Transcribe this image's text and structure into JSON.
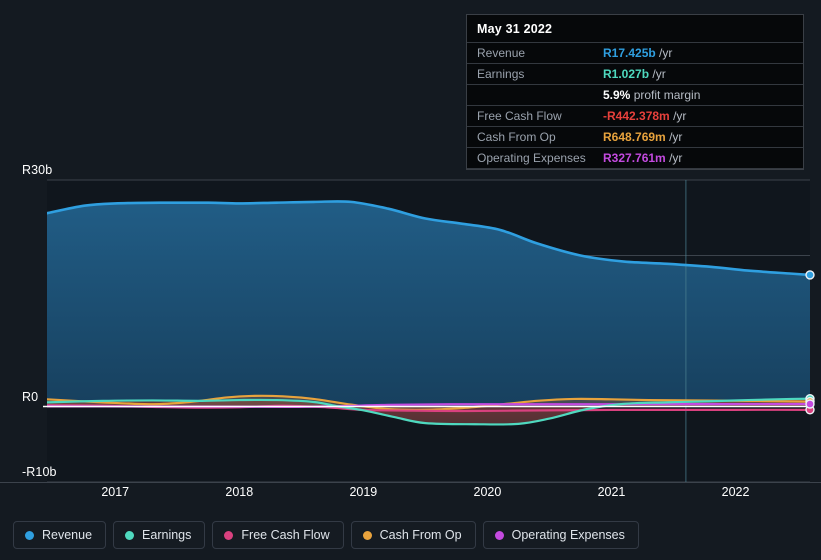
{
  "tooltip": {
    "date": "May 31 2022",
    "rows": [
      {
        "key": "Revenue",
        "amount": "R17.425b",
        "unit": "/yr",
        "color": "#2f9fe0"
      },
      {
        "key": "Earnings",
        "amount": "R1.027b",
        "unit": "/yr",
        "color": "#4fd9bf"
      },
      {
        "key": "",
        "amount": "5.9%",
        "unit": "profit margin",
        "color": "#ffffff",
        "is_margin": true
      },
      {
        "key": "Free Cash Flow",
        "amount": "-R442.378m",
        "unit": "/yr",
        "color": "#e8413c"
      },
      {
        "key": "Cash From Op",
        "amount": "R648.769m",
        "unit": "/yr",
        "color": "#e8a33d"
      },
      {
        "key": "Operating Expenses",
        "amount": "R327.761m",
        "unit": "/yr",
        "color": "#c44ae0"
      }
    ]
  },
  "legend": {
    "items": [
      {
        "label": "Revenue",
        "color": "#2f9fe0"
      },
      {
        "label": "Earnings",
        "color": "#4fd9bf"
      },
      {
        "label": "Free Cash Flow",
        "color": "#d9417f"
      },
      {
        "label": "Cash From Op",
        "color": "#e8a33d"
      },
      {
        "label": "Operating Expenses",
        "color": "#c44ae0"
      }
    ]
  },
  "chart_data": {
    "type": "area",
    "title": "",
    "xlabel": "",
    "ylabel": "",
    "currency_prefix": "R",
    "ylim": [
      -10,
      30
    ],
    "y_ticks": [
      30,
      20,
      10,
      0,
      -10
    ],
    "y_tick_labels": [
      "R30b",
      "",
      "",
      "R0",
      "-R10b"
    ],
    "grid": true,
    "zero_line": 0,
    "legend_position": "bottom-left",
    "x_tick_labels": [
      "2017",
      "2018",
      "2019",
      "2020",
      "2021",
      "2022"
    ],
    "x_tick_values": [
      2017,
      2018,
      2019,
      2020,
      2021,
      2022
    ],
    "x_range": [
      2016.45,
      2022.6
    ],
    "forecast_divider_x": 2021.6,
    "units": "ZAR billions",
    "series": [
      {
        "name": "Revenue",
        "color": "#2f9fe0",
        "fill": "#1d4a6b",
        "x": [
          2016.45,
          2016.75,
          2017.0,
          2017.4,
          2017.75,
          2018.0,
          2018.3,
          2018.6,
          2018.9,
          2019.2,
          2019.5,
          2019.8,
          2020.1,
          2020.4,
          2020.75,
          2021.1,
          2021.45,
          2021.8,
          2022.1,
          2022.45,
          2022.6
        ],
        "values": [
          25.6,
          26.6,
          26.9,
          27.0,
          27.0,
          26.9,
          27.0,
          27.1,
          27.1,
          26.2,
          24.9,
          24.2,
          23.4,
          21.6,
          20.0,
          19.2,
          18.9,
          18.5,
          18.0,
          17.6,
          17.425
        ],
        "end_value": 17.425
      },
      {
        "name": "Earnings",
        "color": "#4fd9bf",
        "fill": "#5d2a2e",
        "x": [
          2016.45,
          2016.9,
          2017.3,
          2017.7,
          2018.0,
          2018.3,
          2018.6,
          2018.8,
          2019.0,
          2019.25,
          2019.5,
          2019.9,
          2020.25,
          2020.5,
          2020.8,
          2021.1,
          2021.45,
          2021.8,
          2022.1,
          2022.45,
          2022.6
        ],
        "values": [
          0.55,
          0.75,
          0.8,
          0.75,
          0.85,
          0.85,
          0.6,
          0.0,
          -0.5,
          -1.4,
          -2.2,
          -2.35,
          -2.3,
          -1.6,
          -0.35,
          0.35,
          0.55,
          0.7,
          0.85,
          1.0,
          1.027
        ],
        "end_value": 1.027
      },
      {
        "name": "Free Cash Flow",
        "color": "#d9417f",
        "x": [
          2016.45,
          2016.9,
          2017.3,
          2017.7,
          2018.0,
          2018.35,
          2018.7,
          2019.0,
          2019.4,
          2019.8,
          2020.2,
          2020.6,
          2021.0,
          2021.4,
          2021.8,
          2022.2,
          2022.6
        ],
        "values": [
          0.15,
          0.1,
          -0.05,
          -0.15,
          -0.1,
          0.1,
          -0.1,
          -0.45,
          -0.55,
          -0.6,
          -0.55,
          -0.5,
          -0.45,
          -0.45,
          -0.45,
          -0.44,
          -0.442
        ],
        "end_value": -0.442
      },
      {
        "name": "Cash From Op",
        "color": "#e8a33d",
        "x": [
          2016.45,
          2016.9,
          2017.3,
          2017.6,
          2017.9,
          2018.1,
          2018.35,
          2018.6,
          2018.9,
          2019.2,
          2019.5,
          2019.8,
          2020.1,
          2020.4,
          2020.7,
          2021.0,
          2021.3,
          2021.7,
          2022.1,
          2022.45,
          2022.6
        ],
        "values": [
          0.95,
          0.55,
          0.3,
          0.6,
          1.2,
          1.4,
          1.35,
          1.0,
          0.25,
          -0.35,
          -0.45,
          -0.2,
          0.25,
          0.75,
          1.0,
          0.95,
          0.85,
          0.8,
          0.75,
          0.68,
          0.649
        ],
        "end_value": 0.649
      },
      {
        "name": "Operating Expenses",
        "color": "#c44ae0",
        "x": [
          2016.45,
          2017.2,
          2017.9,
          2018.4,
          2018.8,
          2019.2,
          2019.7,
          2020.3,
          2020.9,
          2021.5,
          2022.1,
          2022.6
        ],
        "values": [
          0.02,
          0.0,
          -0.02,
          -0.05,
          0.05,
          0.22,
          0.3,
          0.3,
          0.3,
          0.31,
          0.32,
          0.328
        ],
        "end_value": 0.328
      }
    ]
  }
}
